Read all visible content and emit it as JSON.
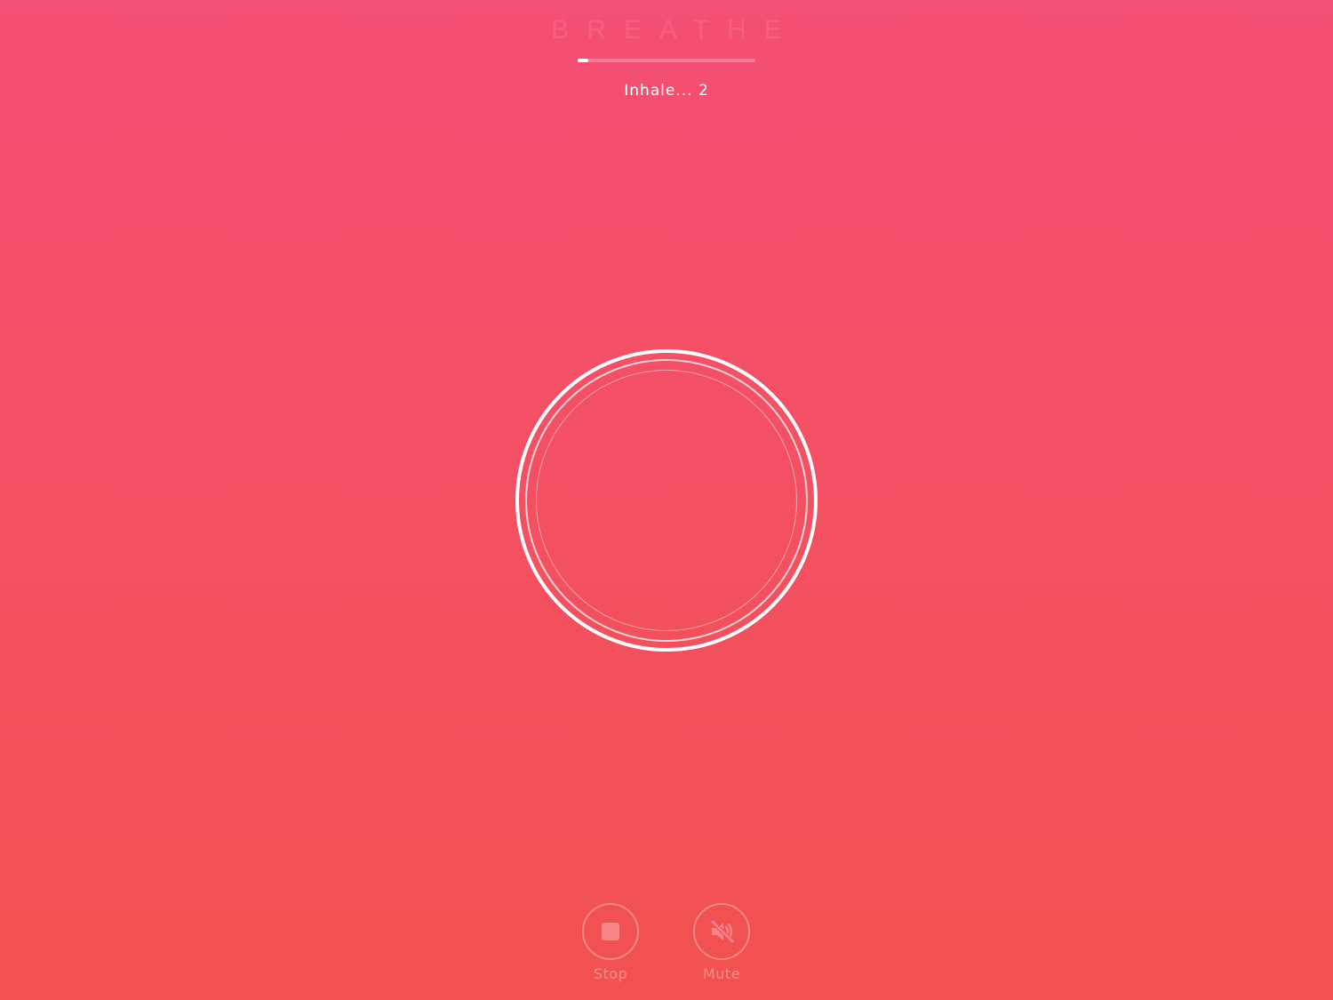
{
  "app": {
    "title": "BREATHE"
  },
  "session": {
    "status_text": "Inhale... 2",
    "progress": 0.06
  },
  "controls": {
    "stop_label": "Stop",
    "mute_label": "Mute"
  },
  "colors": {
    "background_top": "#f44f74",
    "background_bottom": "#f2514f",
    "foreground": "#ffffff"
  },
  "icons": {
    "stop": "stop-icon",
    "mute": "speaker-muted-icon"
  }
}
